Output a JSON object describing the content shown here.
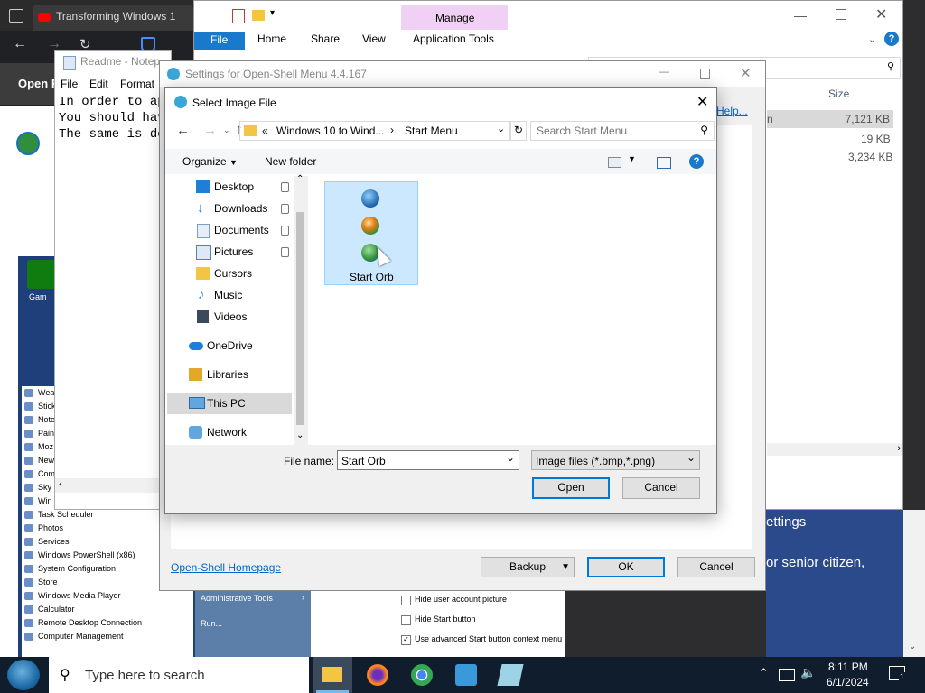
{
  "browser": {
    "tab_title": "Transforming Windows 1",
    "site_partial": "Open F"
  },
  "explorer": {
    "tabs": [
      "File",
      "Home",
      "Share",
      "View",
      "Application Tools"
    ],
    "context_tab": "Manage",
    "size_header": "Size",
    "sizes": [
      "7,121 KB",
      "19 KB",
      "3,234 KB"
    ],
    "partial_name": "n"
  },
  "notepad": {
    "title": "Readme - Notep",
    "menu": [
      "File",
      "Edit",
      "Format"
    ],
    "lines": [
      "In order to ap",
      "You should hav",
      "The same is do"
    ]
  },
  "settings": {
    "title": "Settings for Open-Shell Menu 4.4.167",
    "help_link": "Help...",
    "homepage_link": "Open-Shell Homepage",
    "backup_label": "Backup",
    "ok_label": "OK",
    "cancel_label": "Cancel"
  },
  "dialog": {
    "title": "Select Image File",
    "breadcrumb": [
      "«",
      "Windows 10 to Wind...",
      "Start Menu"
    ],
    "search_placeholder": "Search Start Menu",
    "organize_label": "Organize",
    "new_folder_label": "New folder",
    "nav": {
      "desktop": "Desktop",
      "downloads": "Downloads",
      "documents": "Documents",
      "pictures": "Pictures",
      "cursors": "Cursors",
      "music": "Music",
      "videos": "Videos",
      "onedrive": "OneDrive",
      "libraries": "Libraries",
      "thispc": "This PC",
      "network": "Network"
    },
    "file_item": "Start Orb",
    "filename_label": "File name:",
    "filename_value": "Start Orb",
    "filetype_value": "Image files (*.bmp,*.png)",
    "open_label": "Open",
    "cancel_label": "Cancel"
  },
  "startmenu": {
    "items": [
      "Wea",
      "Stick",
      "Note",
      "Pain",
      "Moz",
      "New",
      "Com",
      "Sky",
      "Win",
      "Task Scheduler",
      "Photos",
      "Services",
      "Windows PowerShell (x86)",
      "System Configuration",
      "Store",
      "Windows Media Player",
      "Calculator",
      "Remote Desktop Connection",
      "Computer Management"
    ],
    "admin_tools": "Administrative Tools",
    "run": "Run...",
    "option1": "Hide user account picture",
    "option2": "Hide Start button",
    "option3": "Use advanced Start button context menu",
    "right_text1": "ettings",
    "right_text2": "or senior citizen,",
    "desktop_icon_label": "Gam"
  },
  "taskbar": {
    "search_placeholder": "Type here to search",
    "time": "8:11 PM",
    "date": "6/1/2024",
    "notification_count": "1"
  }
}
